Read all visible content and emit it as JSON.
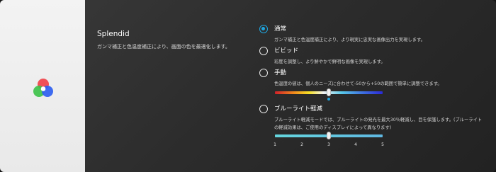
{
  "splendid": {
    "title": "Splendid",
    "description": "ガンマ補正と色温度補正により、画面の色を最適化します。",
    "icon": "rgb-color-circles-icon"
  },
  "options": [
    {
      "label": "通常",
      "description": "ガンマ補正と色温度補正により、より現実に忠実な画像出力を実現します。",
      "selected": true
    },
    {
      "label": "ビビッド",
      "description": "彩度を調整し、より鮮やかで鮮明な画像を実現します。",
      "selected": false
    },
    {
      "label": "手動",
      "description": "色温度の値は、個人のニーズに合わせて-50から+50の範囲で簡単に調整できます。",
      "selected": false
    },
    {
      "label": "ブルーライト軽減",
      "description_line1": "ブルーライト軽減モードでは、ブルーライトの発光を最大30％軽減し、目を保護します。(ブルーライト",
      "description_line2": "の軽減効果は、ご使用のディスプレイによって異なります)",
      "selected": false
    }
  ],
  "color_temperature_slider": {
    "min": -50,
    "max": 50,
    "value": 0
  },
  "blue_light_slider": {
    "ticks": [
      "1",
      "2",
      "3",
      "4",
      "5"
    ],
    "value": 3
  },
  "colors": {
    "accent": "#1fa6e0"
  }
}
